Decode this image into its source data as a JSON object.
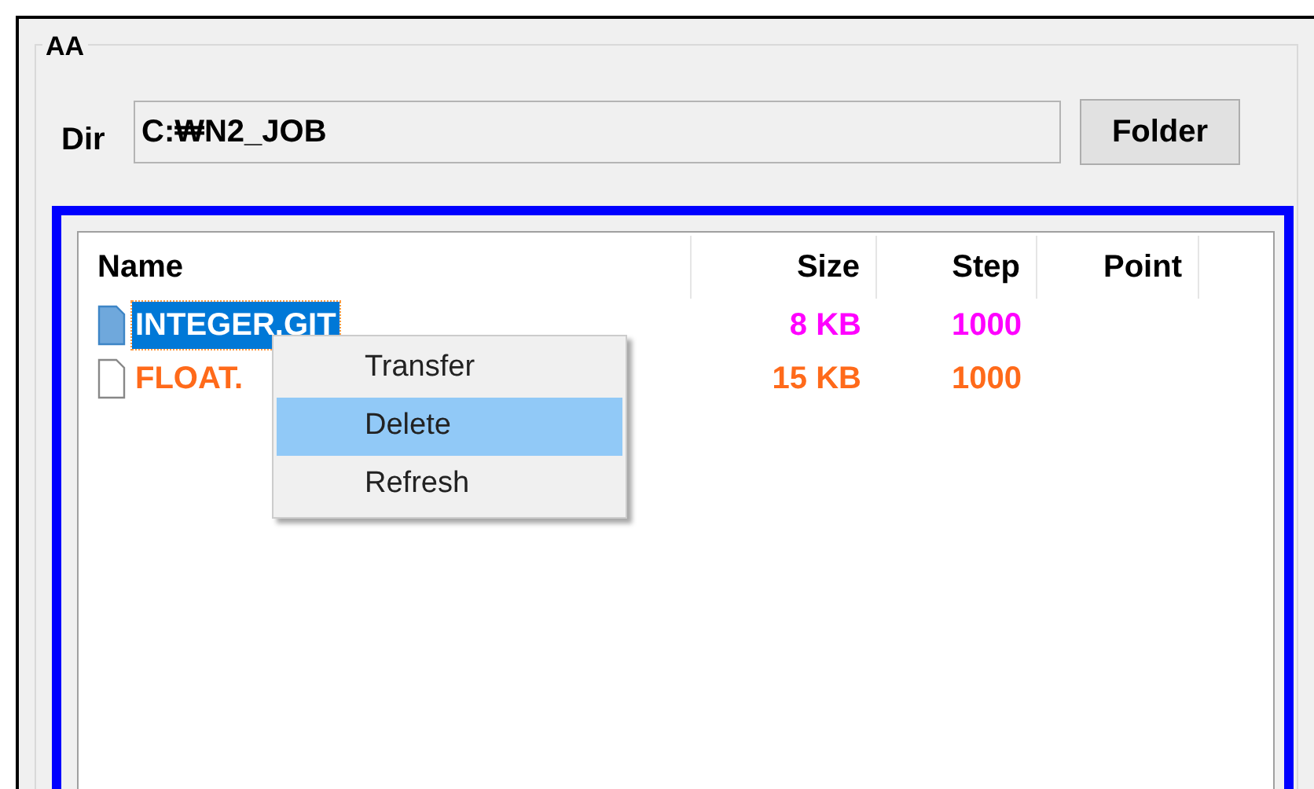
{
  "group": {
    "title": "AA"
  },
  "dir": {
    "label": "Dir",
    "value": "C:₩N2_JOB"
  },
  "folder_button": "Folder",
  "table": {
    "columns": [
      "Name",
      "Size",
      "Step",
      "Point"
    ],
    "rows": [
      {
        "name": "INTEGER.GIT",
        "size": "8 KB",
        "step": "1000",
        "color": "#ff00ff",
        "selected": true
      },
      {
        "name": "FLOAT.",
        "size": "15 KB",
        "step": "1000",
        "color": "#ff6a1a",
        "selected": false
      }
    ]
  },
  "context_menu": [
    {
      "label": "Transfer",
      "selected": false
    },
    {
      "label": "Delete",
      "selected": true
    },
    {
      "label": "Refresh",
      "selected": false
    }
  ]
}
